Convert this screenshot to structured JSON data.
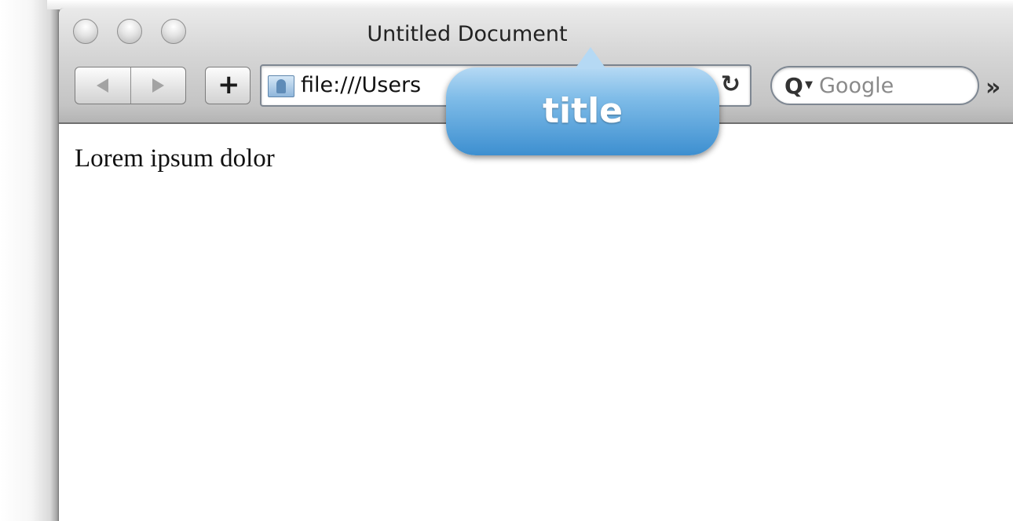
{
  "window": {
    "title": "Untitled Document"
  },
  "toolbar": {
    "add_label": "+",
    "address": "file:///Users",
    "reload_icon": "reload-icon",
    "search_placeholder": "Google",
    "overflow_label": "»"
  },
  "content": {
    "text": "Lorem ipsum dolor"
  },
  "callout": {
    "label": "title"
  },
  "colors": {
    "callout_top": "#b5d9f4",
    "callout_bottom": "#3d8fd0"
  }
}
